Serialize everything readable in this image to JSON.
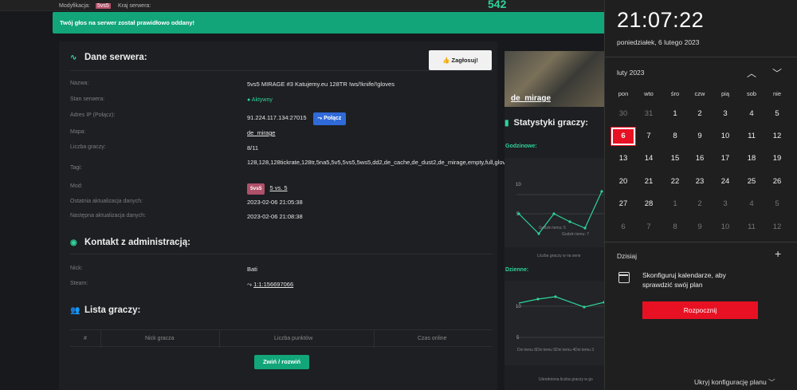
{
  "topbar": {
    "modifier_label": "Modyfikacja:",
    "modifier_badge": "5vs5",
    "country_label": "Kraj serwera:",
    "count": "542"
  },
  "alert": {
    "text": "Twój głos na serwer został prawidłowo oddany!"
  },
  "server": {
    "title": "Dane serwera:",
    "vote_label": "Zagłosuj!",
    "fields": [
      {
        "label": "Nazwa:",
        "value": "5vs5 MIRAGE #3 Katujemy.eu 128TR !ws/!knife/!gloves"
      },
      {
        "label": "Stan serwera:",
        "value": "Aktywny"
      },
      {
        "label": "Adres IP (Połącz):",
        "value": "91.224.117.134:27015"
      },
      {
        "label": "Mapa:",
        "value": "de_mirage"
      },
      {
        "label": "Liczba graczy:",
        "value": "8/11"
      },
      {
        "label": "Tagi:",
        "value": "128,128,128tickrate,128tr,5na5,5v5,5vs5,5ws5,dd2,de_cache,de_dust2,de_mirage,empty,full,gloves,gosetti.pl:40071,knife,kosy,secu,secure"
      },
      {
        "label": "Mod:",
        "value": "5 vs. 5"
      },
      {
        "label": "Ostatnia aktualizacja danych:",
        "value": "2023-02-06 21:05:38"
      },
      {
        "label": "Następna aktualizacja danych:",
        "value": "2023-02-06 21:08:38"
      }
    ],
    "connect_label": "Połącz",
    "mod_badge": "5vs5"
  },
  "admin": {
    "title": "Kontakt z administracją:",
    "nick_label": "Nick:",
    "nick": "Bati",
    "steam_label": "Steam:",
    "steam": "1:1:156697066"
  },
  "players": {
    "title": "Lista graczy:",
    "cols": [
      "#",
      "Nick gracza",
      "Liczba punktów",
      "Czas online"
    ],
    "toggle": "Zwiń / rozwiń"
  },
  "side": {
    "map": "de_mirage",
    "stats_title": "Statystyki graczy:",
    "hourly": "Godzinowe:",
    "daily": "Dzienne:",
    "hourly_caption": "Liczba graczy w na serw",
    "daily_caption": "Uśredniona liczba graczy w go",
    "hourly_ticks": [
      "10",
      "5"
    ],
    "hourly_xlabels": [
      "Godzin temu: 5",
      "Godzin temu: 7"
    ],
    "daily_ticks": [
      "10",
      "5"
    ],
    "daily_xlabels": [
      "Dni temu 6",
      "Dni temu 5",
      "Dni temu 4",
      "Dni temu 3"
    ]
  },
  "panel": {
    "time": "21:07:22",
    "date": "poniedziałek, 6 lutego 2023",
    "month": "luty 2023",
    "weekdays": [
      "pon",
      "wto",
      "śro",
      "czw",
      "pią",
      "sob",
      "nie"
    ],
    "weeks": [
      [
        "30",
        "31",
        "1",
        "2",
        "3",
        "4",
        "5"
      ],
      [
        "6",
        "7",
        "8",
        "9",
        "10",
        "11",
        "12"
      ],
      [
        "13",
        "14",
        "15",
        "16",
        "17",
        "18",
        "19"
      ],
      [
        "20",
        "21",
        "22",
        "23",
        "24",
        "25",
        "26"
      ],
      [
        "27",
        "28",
        "1",
        "2",
        "3",
        "4",
        "5"
      ],
      [
        "6",
        "7",
        "8",
        "9",
        "10",
        "11",
        "12"
      ]
    ],
    "today_label": "Dzisiaj",
    "config_text": "Skonfiguruj kalendarze, aby sprawdzić swój plan",
    "start_label": "Rozpocznij",
    "hide_label": "Ukryj konfigurację planu"
  },
  "colors": {
    "accent": "#2ed39a",
    "alert": "#12a57a",
    "today": "#e81123"
  }
}
